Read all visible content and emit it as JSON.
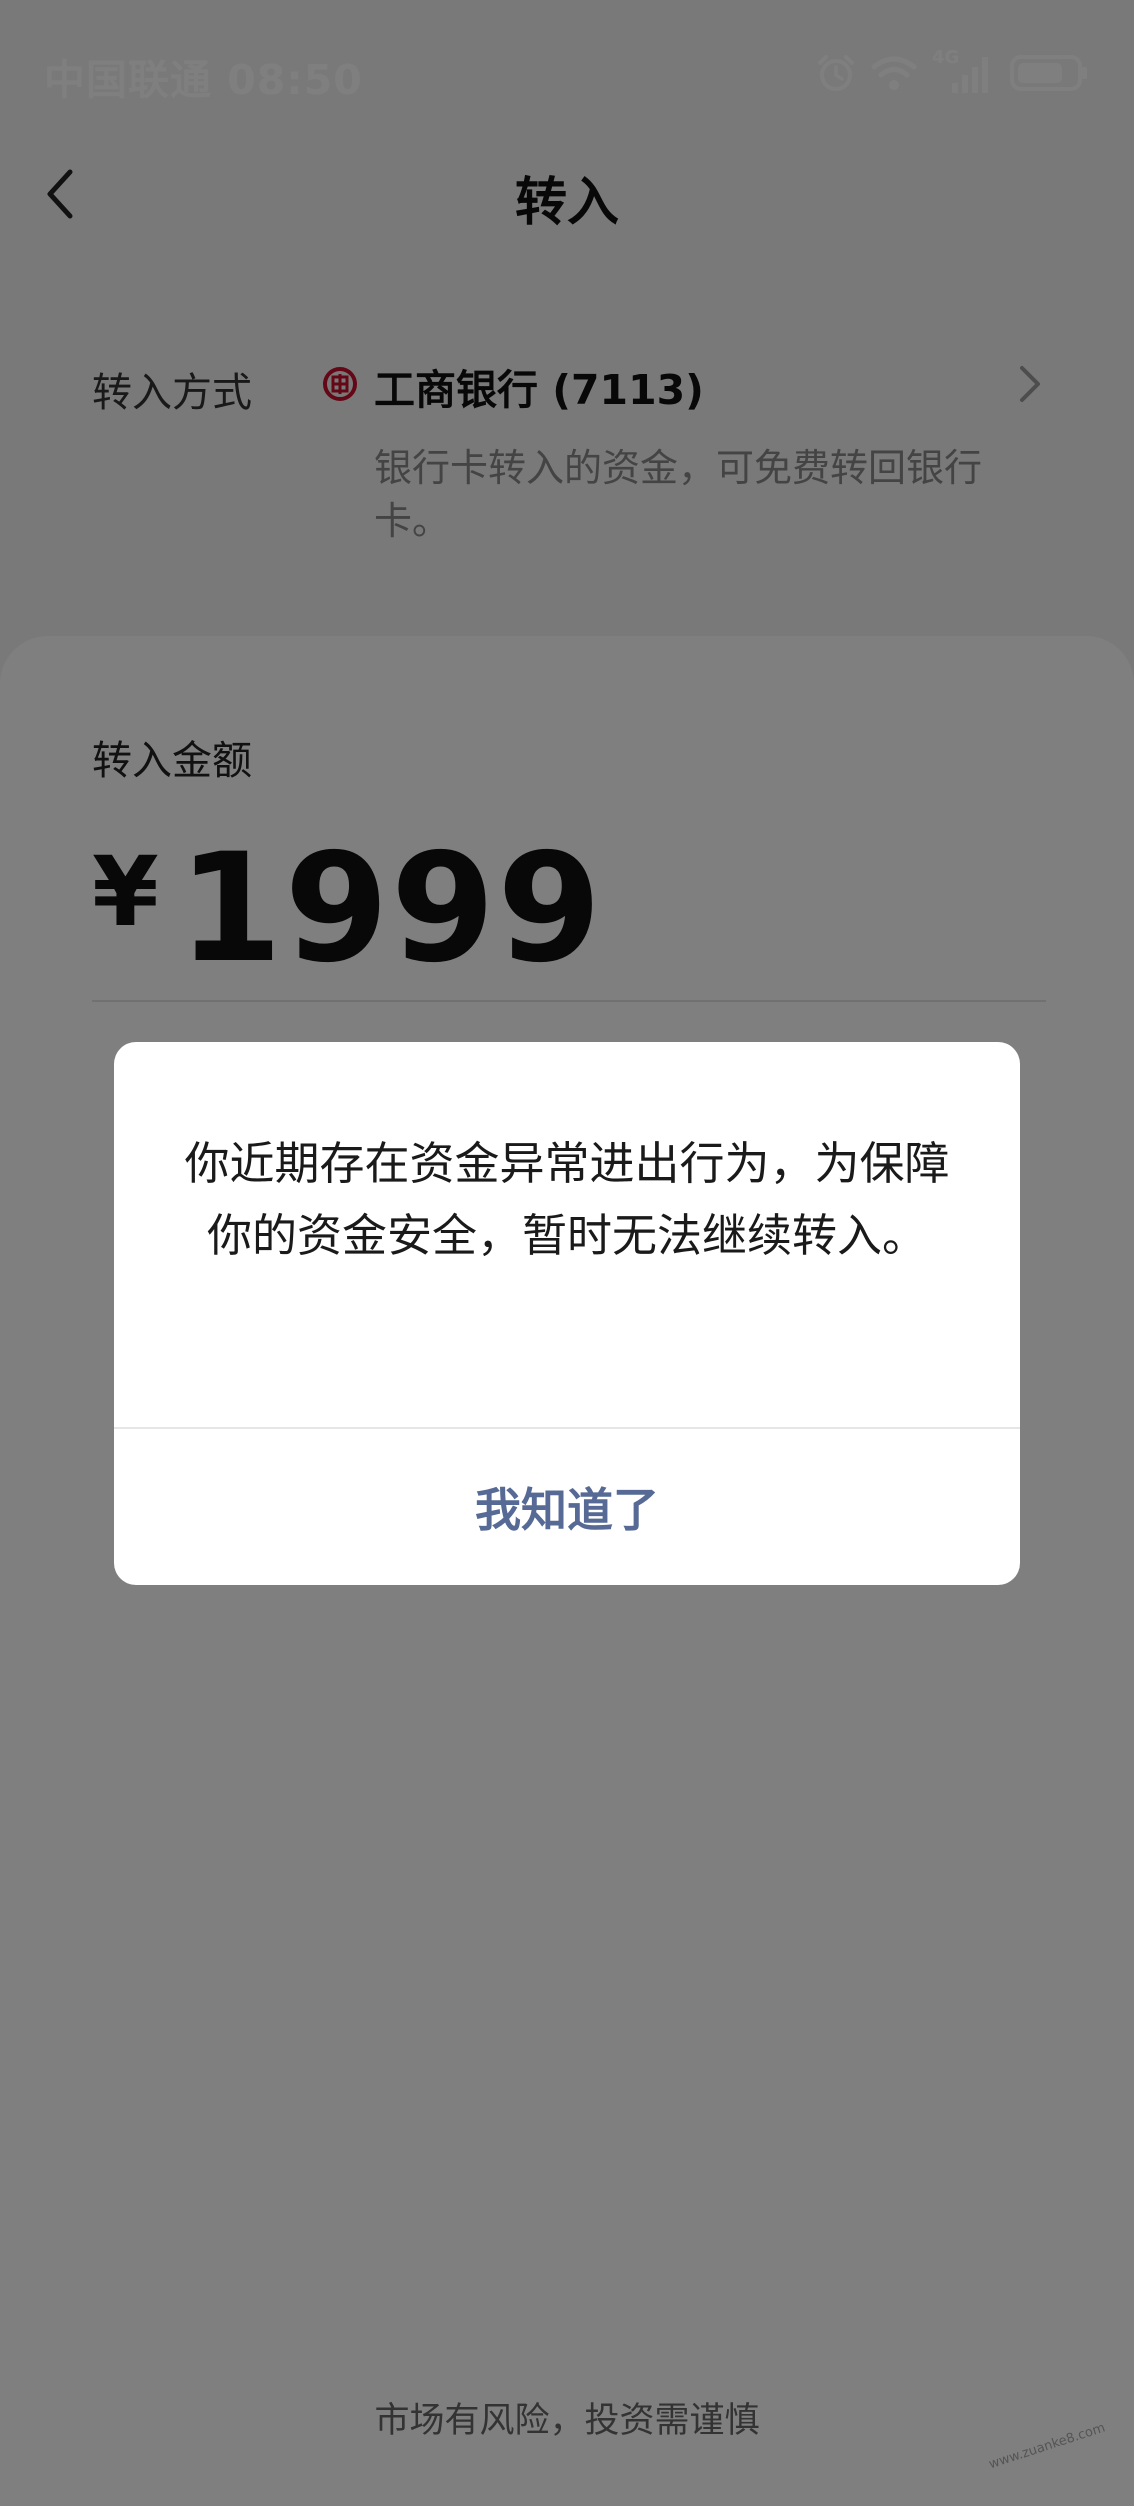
{
  "status_bar": {
    "carrier_time": "中国联通 08:50",
    "network_label": "4G",
    "icons": [
      "alarm-icon",
      "wifi-icon",
      "signal-icon",
      "battery-icon"
    ]
  },
  "header": {
    "title": "转入",
    "back_icon": "chevron-left-icon"
  },
  "transfer_method": {
    "label": "转入方式",
    "bank_name": "工商银行 (7113)",
    "bank_logo_icon": "icbc-logo-icon",
    "hint": "银行卡转入的资金，可免费转回银行卡。"
  },
  "amount": {
    "label": "转入金额",
    "currency": "¥",
    "value": "1999"
  },
  "dialog": {
    "message": "你近期存在资金异常进出行为，为保障你的资金安全，暂时无法继续转入。",
    "confirm_label": "我知道了"
  },
  "footer": {
    "note": "市场有风险，投资需谨慎"
  },
  "watermark": {
    "text": "www.zuanke8.com"
  },
  "colors": {
    "overlay": "rgba(0,0,0,0.5)",
    "dialog_button": "#566a95",
    "bank_logo": "#c8102e",
    "hint_text": "#888888"
  }
}
